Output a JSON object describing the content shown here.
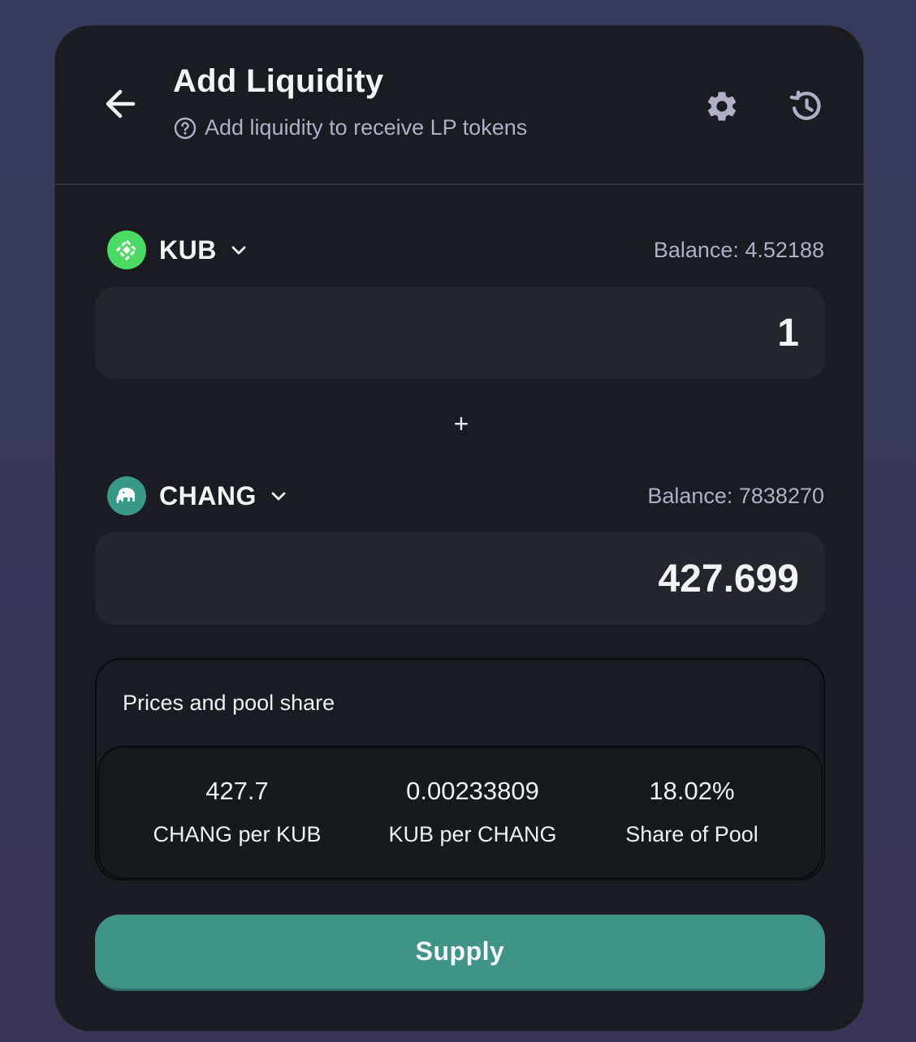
{
  "header": {
    "title": "Add Liquidity",
    "subtitle": "Add liquidity to receive LP tokens"
  },
  "token_a": {
    "symbol": "KUB",
    "balance": "Balance: 4.52188",
    "amount": "1",
    "logo_color": "#4cd964"
  },
  "plus": "+",
  "token_b": {
    "symbol": "CHANG",
    "balance": "Balance: 7838270",
    "amount": "427.699",
    "logo_color": "#3a9a8a"
  },
  "prices": {
    "title": "Prices and pool share",
    "stats": [
      {
        "value": "427.7",
        "label": "CHANG per KUB"
      },
      {
        "value": "0.00233809",
        "label": "KUB per CHANG"
      },
      {
        "value": "18.02%",
        "label": "Share of Pool"
      }
    ]
  },
  "supply_label": "Supply",
  "colors": {
    "accent": "#409487",
    "card_bg": "#1b1c21",
    "muted_text": "#b3aec8"
  },
  "icons": [
    "back-arrow-icon",
    "help-circle-icon",
    "gear-icon",
    "history-icon",
    "chevron-down-icon",
    "kub-logo-icon",
    "chang-elephant-icon"
  ]
}
